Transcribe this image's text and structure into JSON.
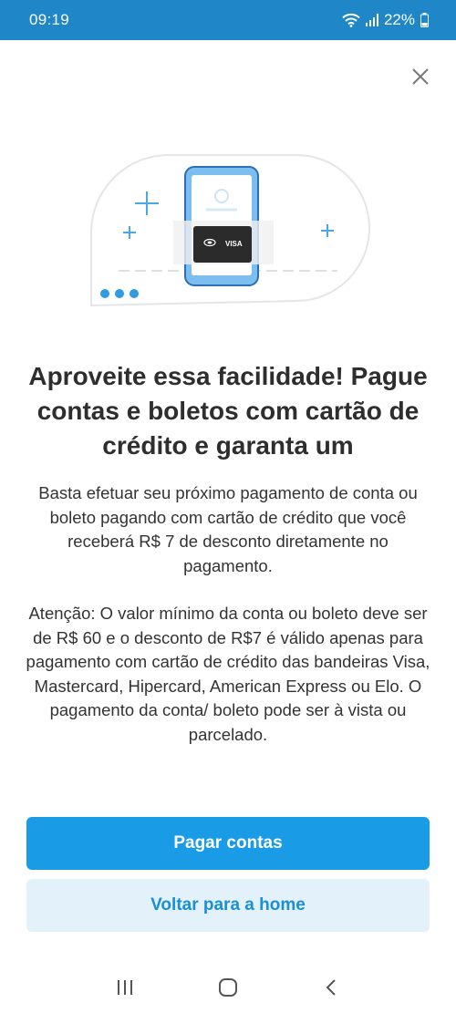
{
  "status_bar": {
    "time": "09:19",
    "battery": "22%",
    "icons": [
      "wifi-icon",
      "signal-icon",
      "battery-icon"
    ],
    "background_color": "#1f86c7"
  },
  "illustration": {
    "card_brand": "VISA"
  },
  "content": {
    "title": "Aproveite essa facilidade! Pague contas e boletos com cartão de crédito e garanta um",
    "paragraph_1": "Basta efetuar seu próximo pagamento de conta ou boleto pagando com cartão de crédito que você receberá R$ 7 de desconto diretamente no pagamento.",
    "paragraph_2": "Atenção: O valor mínimo da conta ou boleto deve ser de R$ 60 e o desconto de R$7 é válido apenas para pagamento com cartão de crédito das bandeiras Visa, Mastercard, Hipercard, American Express ou Elo. O pagamento da conta/ boleto pode ser à vista ou parcelado."
  },
  "buttons": {
    "primary_label": "Pagar contas",
    "secondary_label": "Voltar para a home",
    "primary_color": "#1a9be6",
    "secondary_bg_color": "#e3f1fa"
  },
  "nav_bar": {
    "icons": [
      "recent-apps-icon",
      "home-icon",
      "back-icon"
    ]
  }
}
